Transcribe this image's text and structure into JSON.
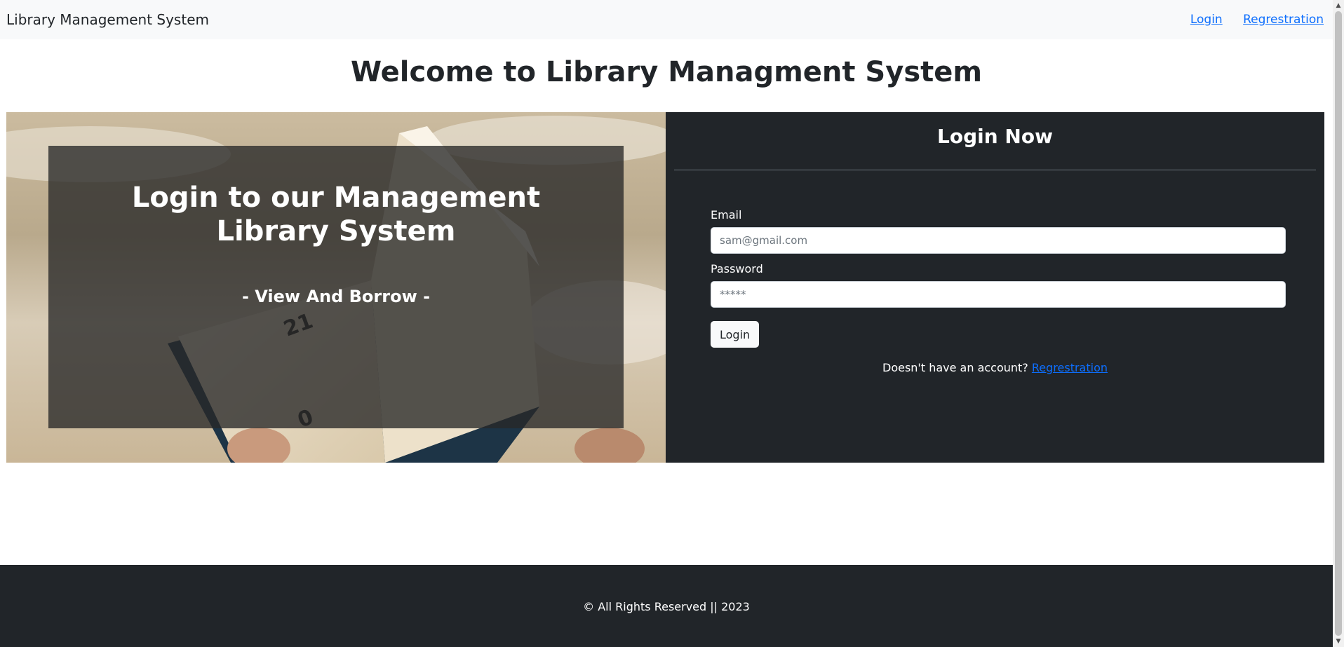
{
  "navbar": {
    "brand": "Library Management System",
    "links": [
      "Login",
      "Regrestration"
    ]
  },
  "page_title": "Welcome to Library Managment System",
  "hero": {
    "overlay_title": "Login to our Management Library System",
    "overlay_subtitle": "- View And Borrow -",
    "image_text": [
      "21",
      "0"
    ]
  },
  "login": {
    "heading": "Login Now",
    "email_label": "Email",
    "email_placeholder": "sam@gmail.com",
    "password_label": "Password",
    "password_placeholder": "*****",
    "button_label": "Login",
    "account_prompt": "Doesn't have an account?",
    "register_link": "Regrestration"
  },
  "footer": {
    "text": "© All Rights Reserved || 2023"
  },
  "colors": {
    "dark": "#212529",
    "light": "#f8f9fa",
    "link": "#0d6efd"
  }
}
